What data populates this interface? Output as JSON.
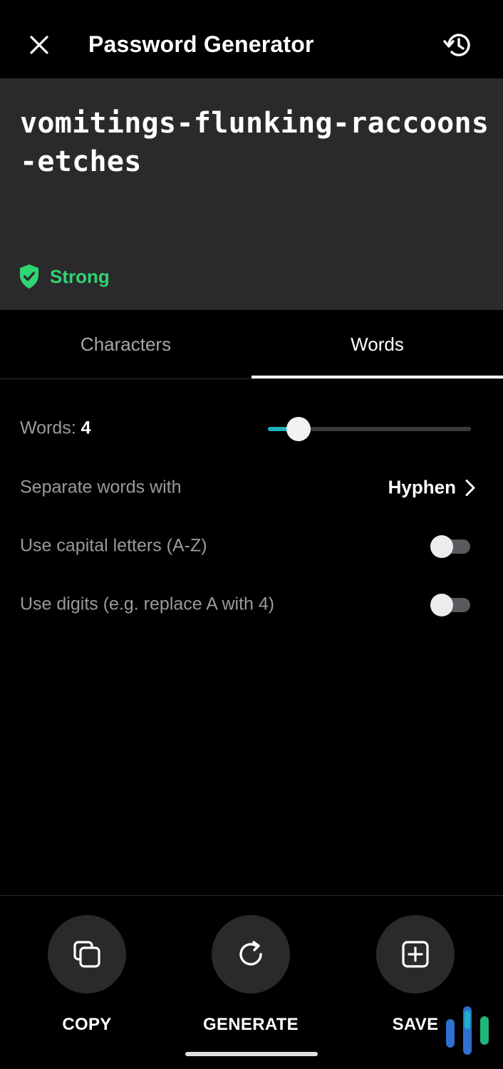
{
  "header": {
    "title": "Password Generator",
    "close_icon": "close-icon",
    "history_icon": "history-icon"
  },
  "password": {
    "value": "vomitings-flunking-raccoons-etches",
    "strength": "Strong",
    "strength_color": "#2ed573"
  },
  "tabs": [
    {
      "label": "Characters",
      "selected": false
    },
    {
      "label": "Words",
      "selected": true
    }
  ],
  "options": {
    "words": {
      "label": "Words: ",
      "value": "4",
      "slider_fraction": 0.15,
      "accent": "#1cb3b8"
    },
    "separator": {
      "label": "Separate words with",
      "value": "Hyphen"
    },
    "capitals": {
      "label": "Use capital letters (A-Z)",
      "enabled": false
    },
    "digits": {
      "label": "Use digits (e.g. replace A with 4)",
      "enabled": false
    }
  },
  "actions": [
    {
      "label": "COPY",
      "icon": "copy-icon"
    },
    {
      "label": "GENERATE",
      "icon": "refresh-icon"
    },
    {
      "label": "SAVE",
      "icon": "add-box-icon"
    }
  ]
}
